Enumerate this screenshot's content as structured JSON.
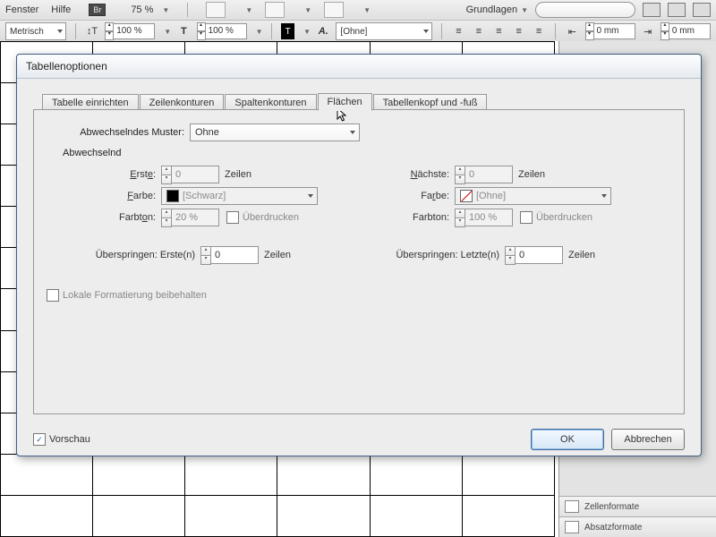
{
  "menubar": {
    "items": [
      "Fenster",
      "Hilfe"
    ],
    "br": "Br",
    "zoom": "75 %",
    "workspace": "Grundlagen"
  },
  "controlbar": {
    "units": "Metrisch",
    "scale1": "100 %",
    "scale2": "100 %",
    "charstyle": "[Ohne]",
    "dim1": "0 mm",
    "dim2": "0 mm"
  },
  "dialog": {
    "title": "Tabellenoptionen",
    "tabs": [
      "Tabelle einrichten",
      "Zeilenkonturen",
      "Spaltenkonturen",
      "Flächen",
      "Tabellenkopf und -fuß"
    ],
    "active_tab": 3,
    "pattern_label": "Abwechselndes Muster:",
    "pattern_value": "Ohne",
    "alt_label": "Abwechselnd",
    "left": {
      "first_label": "Erste:",
      "first_value": "0",
      "first_unit": "Zeilen",
      "color_label": "Farbe:",
      "color_value": "[Schwarz]",
      "tint_label": "Farbton:",
      "tint_value": "20 %",
      "overprint": "Überdrucken"
    },
    "right": {
      "next_label": "Nächste:",
      "next_value": "0",
      "next_unit": "Zeilen",
      "color_label": "Farbe:",
      "color_value": "[Ohne]",
      "tint_label": "Farbton:",
      "tint_value": "100 %",
      "overprint": "Überdrucken"
    },
    "skip_first_label": "Überspringen: Erste(n)",
    "skip_first_value": "0",
    "skip_first_unit": "Zeilen",
    "skip_last_label": "Überspringen: Letzte(n)",
    "skip_last_value": "0",
    "skip_last_unit": "Zeilen",
    "keep_local": "Lokale Formatierung beibehalten",
    "preview": "Vorschau",
    "ok": "OK",
    "cancel": "Abbrechen"
  },
  "panels": {
    "cell_formats": "Zellenformate",
    "para_formats": "Absatzformate"
  }
}
